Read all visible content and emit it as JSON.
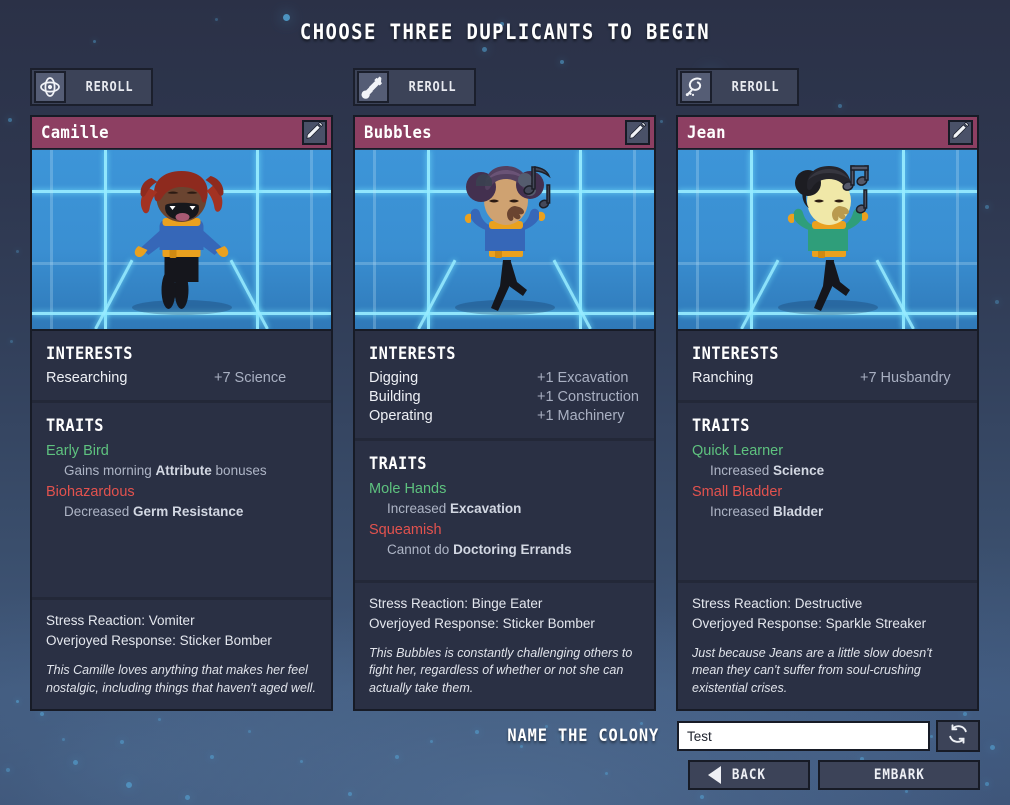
{
  "title": "CHOOSE THREE DUPLICANTS TO BEGIN",
  "colors": {
    "header_band": "#8d3f62",
    "card_bg": "#2a3044",
    "trait_good": "#5ec27f",
    "trait_bad": "#e2524e",
    "portrait_bg": "#3a8fd2",
    "grid_glow": "#96ebff"
  },
  "reroll_label": "REROLL",
  "duplicants": [
    {
      "name": "Camille",
      "reroll_icon": "atom-icon",
      "edit_icon": "pencil-icon",
      "interests_title": "INTERESTS",
      "interests": [
        {
          "name": "Researching",
          "bonus": "+7 Science"
        }
      ],
      "traits_title": "TRAITS",
      "traits": [
        {
          "name": "Early Bird",
          "type": "good",
          "desc_prefix": "Gains morning ",
          "desc_bold": "Attribute",
          "desc_suffix": " bonuses"
        },
        {
          "name": "Biohazardous",
          "type": "bad",
          "desc_prefix": "Decreased ",
          "desc_bold": "Germ Resistance",
          "desc_suffix": ""
        }
      ],
      "stress_reaction": "Stress Reaction: Vomiter",
      "overjoyed_response": "Overjoyed Response: Sticker Bomber",
      "bio": "This Camille loves anything that makes her feel nostalgic, including things that haven't aged well."
    },
    {
      "name": "Bubbles",
      "reroll_icon": "shovel-icon",
      "edit_icon": "pencil-icon",
      "interests_title": "INTERESTS",
      "interests": [
        {
          "name": "Digging",
          "bonus": "+1 Excavation"
        },
        {
          "name": "Building",
          "bonus": "+1 Construction"
        },
        {
          "name": "Operating",
          "bonus": "+1 Machinery"
        }
      ],
      "traits_title": "TRAITS",
      "traits": [
        {
          "name": "Mole Hands",
          "type": "good",
          "desc_prefix": "Increased ",
          "desc_bold": "Excavation",
          "desc_suffix": ""
        },
        {
          "name": "Squeamish",
          "type": "bad",
          "desc_prefix": "Cannot do ",
          "desc_bold": "Doctoring Errands",
          "desc_suffix": ""
        }
      ],
      "stress_reaction": "Stress Reaction: Binge Eater",
      "overjoyed_response": "Overjoyed Response: Sticker Bomber",
      "bio": "This Bubbles is constantly challenging others to fight her, regardless of whether or not she can actually take them."
    },
    {
      "name": "Jean",
      "reroll_icon": "ranching-icon",
      "edit_icon": "pencil-icon",
      "interests_title": "INTERESTS",
      "interests": [
        {
          "name": "Ranching",
          "bonus": "+7 Husbandry"
        }
      ],
      "traits_title": "TRAITS",
      "traits": [
        {
          "name": "Quick Learner",
          "type": "good",
          "desc_prefix": "Increased ",
          "desc_bold": "Science",
          "desc_suffix": ""
        },
        {
          "name": "Small Bladder",
          "type": "bad",
          "desc_prefix": "Increased ",
          "desc_bold": "Bladder",
          "desc_suffix": ""
        }
      ],
      "stress_reaction": "Stress Reaction: Destructive",
      "overjoyed_response": "Overjoyed Response: Sparkle Streaker",
      "bio": "Just because Jeans are a little slow doesn't mean they can't suffer from soul-crushing existential crises."
    }
  ],
  "bottom": {
    "name_label": "NAME THE COLONY",
    "colony_name": "Test",
    "colony_name_placeholder": "",
    "randomize_icon": "refresh-icon",
    "back_label": "BACK",
    "back_icon": "triangle-left-icon",
    "embark_label": "EMBARK"
  }
}
